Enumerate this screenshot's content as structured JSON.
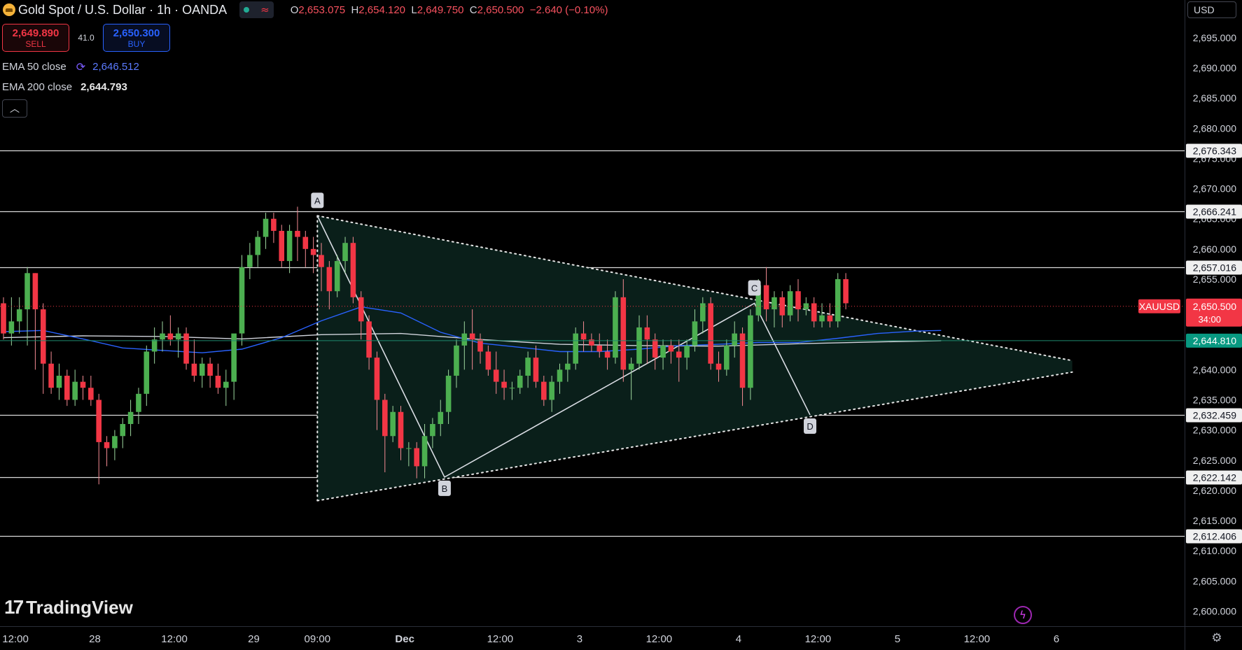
{
  "header": {
    "title": "Gold Spot / U.S. Dollar · 1h · OANDA",
    "ohlc": {
      "o_label": "O",
      "open": "2,653.075",
      "h_label": "H",
      "high": "2,654.120",
      "l_label": "L",
      "low": "2,649.750",
      "c_label": "C",
      "close": "2,650.500",
      "change": "−2.640 (−0.10%)"
    }
  },
  "trade": {
    "sell_price": "2,649.890",
    "sell_label": "SELL",
    "spread": "41.0",
    "buy_price": "2,650.300",
    "buy_label": "BUY"
  },
  "indicators": {
    "ema50_label": "EMA 50 close",
    "ema50_value": "2,646.512",
    "ema200_label": "EMA 200 close",
    "ema200_value": "2,644.793"
  },
  "currency": "USD",
  "brand": "TradingView",
  "colors": {
    "up": "#4caf50",
    "down": "#f23645",
    "ema50": "#2962ff",
    "ema200": "#d1d4dc",
    "grid": "#000000",
    "background": "#000000"
  },
  "chart_data": {
    "type": "candlestick",
    "symbol": "XAUUSD",
    "interval": "1h",
    "ylim": [
      2597.5,
      2698.0
    ],
    "y_ticks": [
      2600,
      2605,
      2610,
      2615,
      2620,
      2625,
      2630,
      2635,
      2640,
      2645,
      2650,
      2655,
      2660,
      2665,
      2670,
      2675,
      2680,
      2685,
      2690,
      2695
    ],
    "x_ticks": [
      {
        "label": "12:00",
        "bar": 1.5
      },
      {
        "label": "28",
        "bar": 11.5
      },
      {
        "label": "12:00",
        "bar": 21.5
      },
      {
        "label": "29",
        "bar": 31.5
      },
      {
        "label": "09:00",
        "bar": 39.5
      },
      {
        "label": "Dec",
        "bar": 50.5
      },
      {
        "label": "12:00",
        "bar": 62.5
      },
      {
        "label": "3",
        "bar": 72.5
      },
      {
        "label": "12:00",
        "bar": 82.5
      },
      {
        "label": "4",
        "bar": 92.5
      },
      {
        "label": "12:00",
        "bar": 102.5
      },
      {
        "label": "5",
        "bar": 112.5
      },
      {
        "label": "12:00",
        "bar": 122.5
      },
      {
        "label": "6",
        "bar": 132.5
      }
    ],
    "candles": [
      [
        2651,
        2652,
        2645,
        2646
      ],
      [
        2646,
        2652,
        2644,
        2648
      ],
      [
        2648,
        2652,
        2646,
        2650
      ],
      [
        2650,
        2657,
        2644,
        2656
      ],
      [
        2656,
        2656,
        2640,
        2650
      ],
      [
        2650,
        2651,
        2636,
        2641
      ],
      [
        2641,
        2643,
        2636,
        2637
      ],
      [
        2637,
        2641,
        2635,
        2639
      ],
      [
        2639,
        2640,
        2634,
        2635
      ],
      [
        2635,
        2640,
        2634,
        2638
      ],
      [
        2638,
        2639,
        2635,
        2637
      ],
      [
        2637,
        2639,
        2634,
        2635
      ],
      [
        2635,
        2636,
        2621,
        2628
      ],
      [
        2628,
        2629,
        2624,
        2627
      ],
      [
        2627,
        2630,
        2625,
        2629
      ],
      [
        2629,
        2632,
        2627,
        2631
      ],
      [
        2631,
        2635,
        2629,
        2633
      ],
      [
        2633,
        2637,
        2631,
        2636
      ],
      [
        2636,
        2644,
        2634,
        2643
      ],
      [
        2643,
        2647,
        2641,
        2645
      ],
      [
        2645,
        2648,
        2643,
        2646
      ],
      [
        2646,
        2649,
        2644,
        2645
      ],
      [
        2645,
        2647,
        2642,
        2646
      ],
      [
        2646,
        2647,
        2640,
        2641
      ],
      [
        2641,
        2645,
        2638,
        2639
      ],
      [
        2639,
        2642,
        2637,
        2641
      ],
      [
        2641,
        2642,
        2637,
        2639
      ],
      [
        2639,
        2641,
        2636,
        2637
      ],
      [
        2637,
        2640,
        2634,
        2638
      ],
      [
        2638,
        2642,
        2635,
        2646
      ],
      [
        2646,
        2659,
        2644,
        2657
      ],
      [
        2657,
        2661,
        2655,
        2659
      ],
      [
        2659,
        2663,
        2657,
        2662
      ],
      [
        2662,
        2666,
        2660,
        2665
      ],
      [
        2665,
        2666,
        2661,
        2663
      ],
      [
        2663,
        2664,
        2657,
        2658
      ],
      [
        2658,
        2664,
        2656,
        2663
      ],
      [
        2663,
        2667,
        2658,
        2662
      ],
      [
        2662,
        2663,
        2657,
        2660
      ],
      [
        2660,
        2662,
        2656,
        2659
      ],
      [
        2659,
        2661,
        2653,
        2657
      ],
      [
        2657,
        2658,
        2650,
        2653
      ],
      [
        2653,
        2659,
        2652,
        2658
      ],
      [
        2658,
        2662,
        2656,
        2661
      ],
      [
        2661,
        2662,
        2651,
        2652
      ],
      [
        2652,
        2653,
        2645,
        2648
      ],
      [
        2648,
        2649,
        2640,
        2642
      ],
      [
        2642,
        2643,
        2630,
        2635
      ],
      [
        2635,
        2636,
        2623,
        2629
      ],
      [
        2629,
        2634,
        2628,
        2633
      ],
      [
        2633,
        2634,
        2625,
        2627
      ],
      [
        2627,
        2628,
        2624,
        2627
      ],
      [
        2627,
        2628,
        2622,
        2624
      ],
      [
        2624,
        2631,
        2622,
        2629
      ],
      [
        2629,
        2632,
        2627,
        2631
      ],
      [
        2631,
        2635,
        2629,
        2633
      ],
      [
        2633,
        2640,
        2631,
        2639
      ],
      [
        2639,
        2645,
        2637,
        2644
      ],
      [
        2644,
        2648,
        2640,
        2646
      ],
      [
        2646,
        2650,
        2640,
        2645
      ],
      [
        2645,
        2646,
        2641,
        2643
      ],
      [
        2643,
        2644,
        2639,
        2640
      ],
      [
        2640,
        2643,
        2636,
        2638
      ],
      [
        2638,
        2640,
        2635,
        2637
      ],
      [
        2637,
        2638,
        2635,
        2637
      ],
      [
        2637,
        2640,
        2636,
        2639
      ],
      [
        2639,
        2643,
        2637,
        2642
      ],
      [
        2642,
        2644,
        2637,
        2638
      ],
      [
        2638,
        2639,
        2634,
        2635
      ],
      [
        2635,
        2639,
        2633,
        2638
      ],
      [
        2638,
        2641,
        2636,
        2640
      ],
      [
        2640,
        2643,
        2638,
        2641
      ],
      [
        2641,
        2647,
        2640,
        2646
      ],
      [
        2646,
        2648,
        2643,
        2645
      ],
      [
        2645,
        2646,
        2643,
        2644
      ],
      [
        2644,
        2646,
        2642,
        2643
      ],
      [
        2643,
        2645,
        2640,
        2642
      ],
      [
        2642,
        2653,
        2641,
        2652
      ],
      [
        2652,
        2655,
        2638,
        2640
      ],
      [
        2640,
        2642,
        2635,
        2641
      ],
      [
        2641,
        2649,
        2640,
        2647
      ],
      [
        2647,
        2649,
        2641,
        2645
      ],
      [
        2645,
        2646,
        2640,
        2642
      ],
      [
        2642,
        2645,
        2640,
        2644
      ],
      [
        2644,
        2645,
        2641,
        2643
      ],
      [
        2643,
        2645,
        2638,
        2642
      ],
      [
        2642,
        2645,
        2640,
        2644
      ],
      [
        2644,
        2650,
        2643,
        2648
      ],
      [
        2648,
        2652,
        2646,
        2651
      ],
      [
        2651,
        2652,
        2640,
        2641
      ],
      [
        2641,
        2643,
        2638,
        2640
      ],
      [
        2640,
        2645,
        2639,
        2644
      ],
      [
        2644,
        2648,
        2642,
        2646
      ],
      [
        2646,
        2647,
        2634,
        2637
      ],
      [
        2637,
        2650,
        2635,
        2649
      ],
      [
        2649,
        2655,
        2648,
        2654
      ],
      [
        2654,
        2657,
        2648,
        2650
      ],
      [
        2650,
        2653,
        2647,
        2652
      ],
      [
        2652,
        2653,
        2647,
        2649
      ],
      [
        2649,
        2654,
        2648,
        2653
      ],
      [
        2653,
        2655,
        2648,
        2650
      ],
      [
        2650,
        2652,
        2649,
        2651
      ],
      [
        2651,
        2652,
        2647,
        2648
      ],
      [
        2648,
        2651,
        2647,
        2649
      ],
      [
        2649,
        2651,
        2647,
        2648
      ],
      [
        2648,
        2656,
        2647,
        2655
      ],
      [
        2655,
        2656,
        2650,
        2651
      ]
    ],
    "ema50": [
      [
        0,
        2646.3
      ],
      [
        5,
        2646.5
      ],
      [
        10,
        2645.1
      ],
      [
        15,
        2643.6
      ],
      [
        20,
        2643.2
      ],
      [
        25,
        2642.8
      ],
      [
        30,
        2643.4
      ],
      [
        35,
        2645.3
      ],
      [
        40,
        2648.1
      ],
      [
        45,
        2650.4
      ],
      [
        50,
        2649.4
      ],
      [
        55,
        2646.2
      ],
      [
        60,
        2644.4
      ],
      [
        65,
        2643.7
      ],
      [
        70,
        2643.0
      ],
      [
        75,
        2643.0
      ],
      [
        80,
        2643.4
      ],
      [
        85,
        2644.0
      ],
      [
        90,
        2644.2
      ],
      [
        95,
        2644.5
      ],
      [
        100,
        2644.5
      ],
      [
        105,
        2645.2
      ],
      [
        110,
        2646.0
      ],
      [
        115,
        2646.4
      ],
      [
        118,
        2646.5
      ]
    ],
    "ema200": [
      [
        0,
        2645.3
      ],
      [
        10,
        2645.6
      ],
      [
        20,
        2645.5
      ],
      [
        30,
        2645.1
      ],
      [
        40,
        2645.8
      ],
      [
        50,
        2646.0
      ],
      [
        60,
        2645.0
      ],
      [
        70,
        2644.2
      ],
      [
        80,
        2644.0
      ],
      [
        90,
        2643.9
      ],
      [
        100,
        2644.3
      ],
      [
        110,
        2644.6
      ],
      [
        118,
        2644.8
      ]
    ],
    "hlines": [
      {
        "value": 2676.343,
        "label": "2,676.343"
      },
      {
        "value": 2666.241,
        "label": "2,666.241"
      },
      {
        "value": 2657.016,
        "label": "2,657.016"
      },
      {
        "value": 2632.459,
        "label": "2,632.459"
      },
      {
        "value": 2622.142,
        "label": "2,622.142"
      },
      {
        "value": 2612.406,
        "label": "2,612.406"
      }
    ],
    "price_marker": {
      "value": 2650.5,
      "label": "2,650.500",
      "countdown": "34:00",
      "symbol": "XAUUSD"
    },
    "ema_marker": {
      "value": 2644.81,
      "label": "2,644.810"
    },
    "pattern": {
      "points": [
        {
          "label": "A",
          "bar": 39.5,
          "price": 2665.5
        },
        {
          "label": "B",
          "bar": 55.5,
          "price": 2622.2
        },
        {
          "label": "C",
          "bar": 94.5,
          "price": 2651.0
        },
        {
          "label": "D",
          "bar": 101.5,
          "price": 2632.5
        }
      ],
      "upper_line": [
        [
          39.5,
          2665.5
        ],
        [
          134.5,
          2641.5
        ]
      ],
      "lower_line": [
        [
          39.5,
          2618.3
        ],
        [
          134.5,
          2639.6
        ]
      ],
      "vertical": [
        [
          39.5,
          2665.5
        ],
        [
          39.5,
          2618.3
        ]
      ]
    }
  }
}
